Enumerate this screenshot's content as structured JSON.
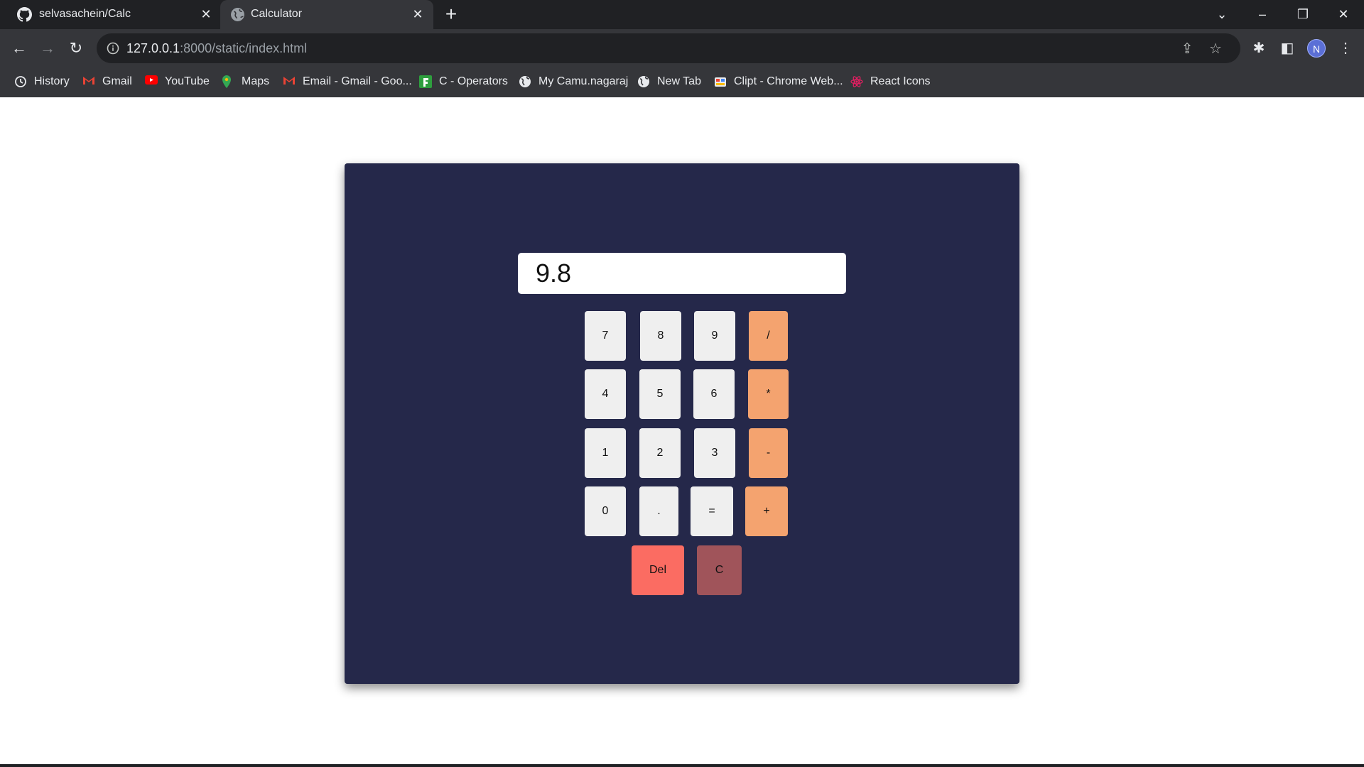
{
  "browser": {
    "tabs": [
      {
        "title": "selvasachein/Calc",
        "icon": "github-icon"
      },
      {
        "title": "Calculator",
        "icon": "globe-icon",
        "active": true
      }
    ],
    "url_host": "127.0.0.1",
    "url_rest": ":8000/static/index.html",
    "profile_initial": "N",
    "bookmarks": [
      {
        "label": "History",
        "icon": "history-icon"
      },
      {
        "label": "Gmail",
        "icon": "gmail-icon"
      },
      {
        "label": "YouTube",
        "icon": "youtube-icon"
      },
      {
        "label": "Maps",
        "icon": "maps-icon"
      },
      {
        "label": "Email - Gmail - Goo...",
        "icon": "gmail-icon"
      },
      {
        "label": "C - Operators",
        "icon": "operators-icon"
      },
      {
        "label": "My Camu.nagaraj",
        "icon": "globe-icon"
      },
      {
        "label": "New Tab",
        "icon": "globe-icon"
      },
      {
        "label": "Clipt - Chrome Web...",
        "icon": "clipt-icon"
      },
      {
        "label": "React Icons",
        "icon": "react-icon"
      }
    ]
  },
  "calculator": {
    "display_value": "9.8",
    "keys": {
      "k7": "7",
      "k8": "8",
      "k9": "9",
      "div": "/",
      "k4": "4",
      "k5": "5",
      "k6": "6",
      "mul": "*",
      "k1": "1",
      "k2": "2",
      "k3": "3",
      "sub": "-",
      "k0": "0",
      "dot": ".",
      "eq": "=",
      "add": "+",
      "del": "Del",
      "clear": "C"
    },
    "colors": {
      "card": "#25284a",
      "number_key": "#efefef",
      "operator_key": "#f4a36f",
      "delete_key": "#fb6c62",
      "clear_key": "#a0545a"
    }
  }
}
